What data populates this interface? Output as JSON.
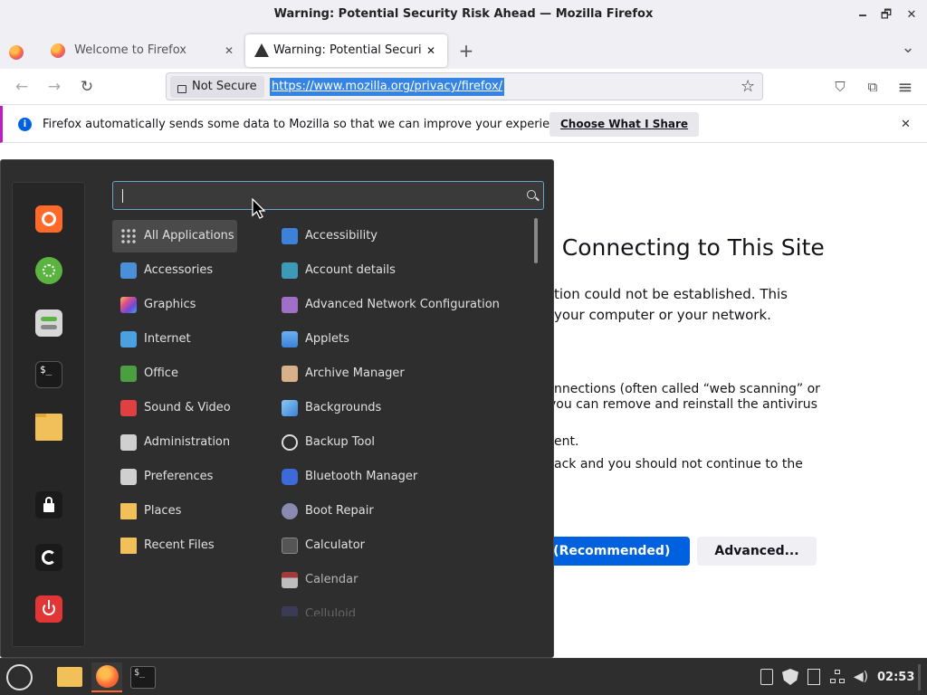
{
  "window": {
    "title": "Warning: Potential Security Risk Ahead — Mozilla Firefox",
    "minimize_glyph": "🗕",
    "maximize_glyph": "🗗",
    "close_glyph": "✕"
  },
  "tabs": [
    {
      "label": "Welcome to Firefox",
      "icon": "firefox-icon"
    },
    {
      "label": "Warning: Potential Security",
      "icon": "warning-icon",
      "active": true
    }
  ],
  "tabbar": {
    "new_tab_glyph": "+",
    "list_glyph": "⌄",
    "close_glyph": "✕"
  },
  "navbar": {
    "not_secure_label": "Not Secure",
    "url": "https://www.mozilla.org/privacy/firefox/",
    "back_glyph": "←",
    "forward_glyph": "→",
    "reload_glyph": "↻",
    "bookmark_glyph": "☆",
    "pocket_glyph": "⛉",
    "extensions_glyph": "⧉",
    "menu_glyph": "≡"
  },
  "infobar": {
    "icon_glyph": "i",
    "message": "Firefox automatically sends some data to Mozilla so that we can improve your experience.",
    "button_label": "Choose What I Share",
    "close_glyph": "✕"
  },
  "page": {
    "title_fragment": "y Connecting to This Site",
    "paragraph_lines": [
      "tion could not be established. This",
      "your computer or your network."
    ],
    "detail_lines": [
      "nnections (often called “web scanning” or",
      " you can remove and reinstall the antivirus",
      "ent.",
      "ack and you should not continue to the"
    ],
    "back_button_label": "k (Recommended)",
    "advanced_button_label": "Advanced..."
  },
  "menu": {
    "search_value": "",
    "search_icon": "search-icon",
    "favorites": [
      {
        "name": "firefox",
        "color": "#ff6a2b"
      },
      {
        "name": "software-manager",
        "color": "#5ab43f"
      },
      {
        "name": "settings",
        "color": "#d8d8d8"
      },
      {
        "name": "terminal",
        "color": "#1a1a1a"
      },
      {
        "name": "files",
        "color": "#f2c058"
      },
      {
        "name": "lock-screen",
        "color": "#1a1a1a"
      },
      {
        "name": "logout",
        "color": "#1a1a1a"
      },
      {
        "name": "shutdown",
        "color": "#e23535"
      }
    ],
    "categories": [
      {
        "label": "All Applications",
        "icon_color": "#cccccc"
      },
      {
        "label": "Accessories",
        "icon_color": "#4a90d9"
      },
      {
        "label": "Graphics",
        "icon_color": "#e0508a"
      },
      {
        "label": "Internet",
        "icon_color": "#4aa0e0"
      },
      {
        "label": "Office",
        "icon_color": "#4aa040"
      },
      {
        "label": "Sound & Video",
        "icon_color": "#e04040"
      },
      {
        "label": "Administration",
        "icon_color": "#d0d0d0"
      },
      {
        "label": "Preferences",
        "icon_color": "#d0d0d0"
      },
      {
        "label": "Places",
        "icon_color": "#f2c058"
      },
      {
        "label": "Recent Files",
        "icon_color": "#f2c058"
      }
    ],
    "apps": [
      {
        "label": "Accessibility",
        "icon_color": "#3c82d8"
      },
      {
        "label": "Account details",
        "icon_color": "#3c9ab8"
      },
      {
        "label": "Advanced Network Configuration",
        "icon_color": "#a070c8"
      },
      {
        "label": "Applets",
        "icon_color": "#3c82d8"
      },
      {
        "label": "Archive Manager",
        "icon_color": "#d8b08a"
      },
      {
        "label": "Backgrounds",
        "icon_color": "#3c82d8"
      },
      {
        "label": "Backup Tool",
        "icon_color": "#444444"
      },
      {
        "label": "Bluetooth Manager",
        "icon_color": "#3c6ad8"
      },
      {
        "label": "Boot Repair",
        "icon_color": "#8a8ab0"
      },
      {
        "label": "Calculator",
        "icon_color": "#555555"
      },
      {
        "label": "Calendar",
        "icon_color": "#c84040"
      },
      {
        "label": "Celluloid",
        "icon_color": "#5a5ab8"
      }
    ]
  },
  "taskbar": {
    "clock": "02:53",
    "tray_icons": [
      "clipboard-icon",
      "shield-icon",
      "notes-icon",
      "network-icon",
      "volume-icon"
    ]
  }
}
